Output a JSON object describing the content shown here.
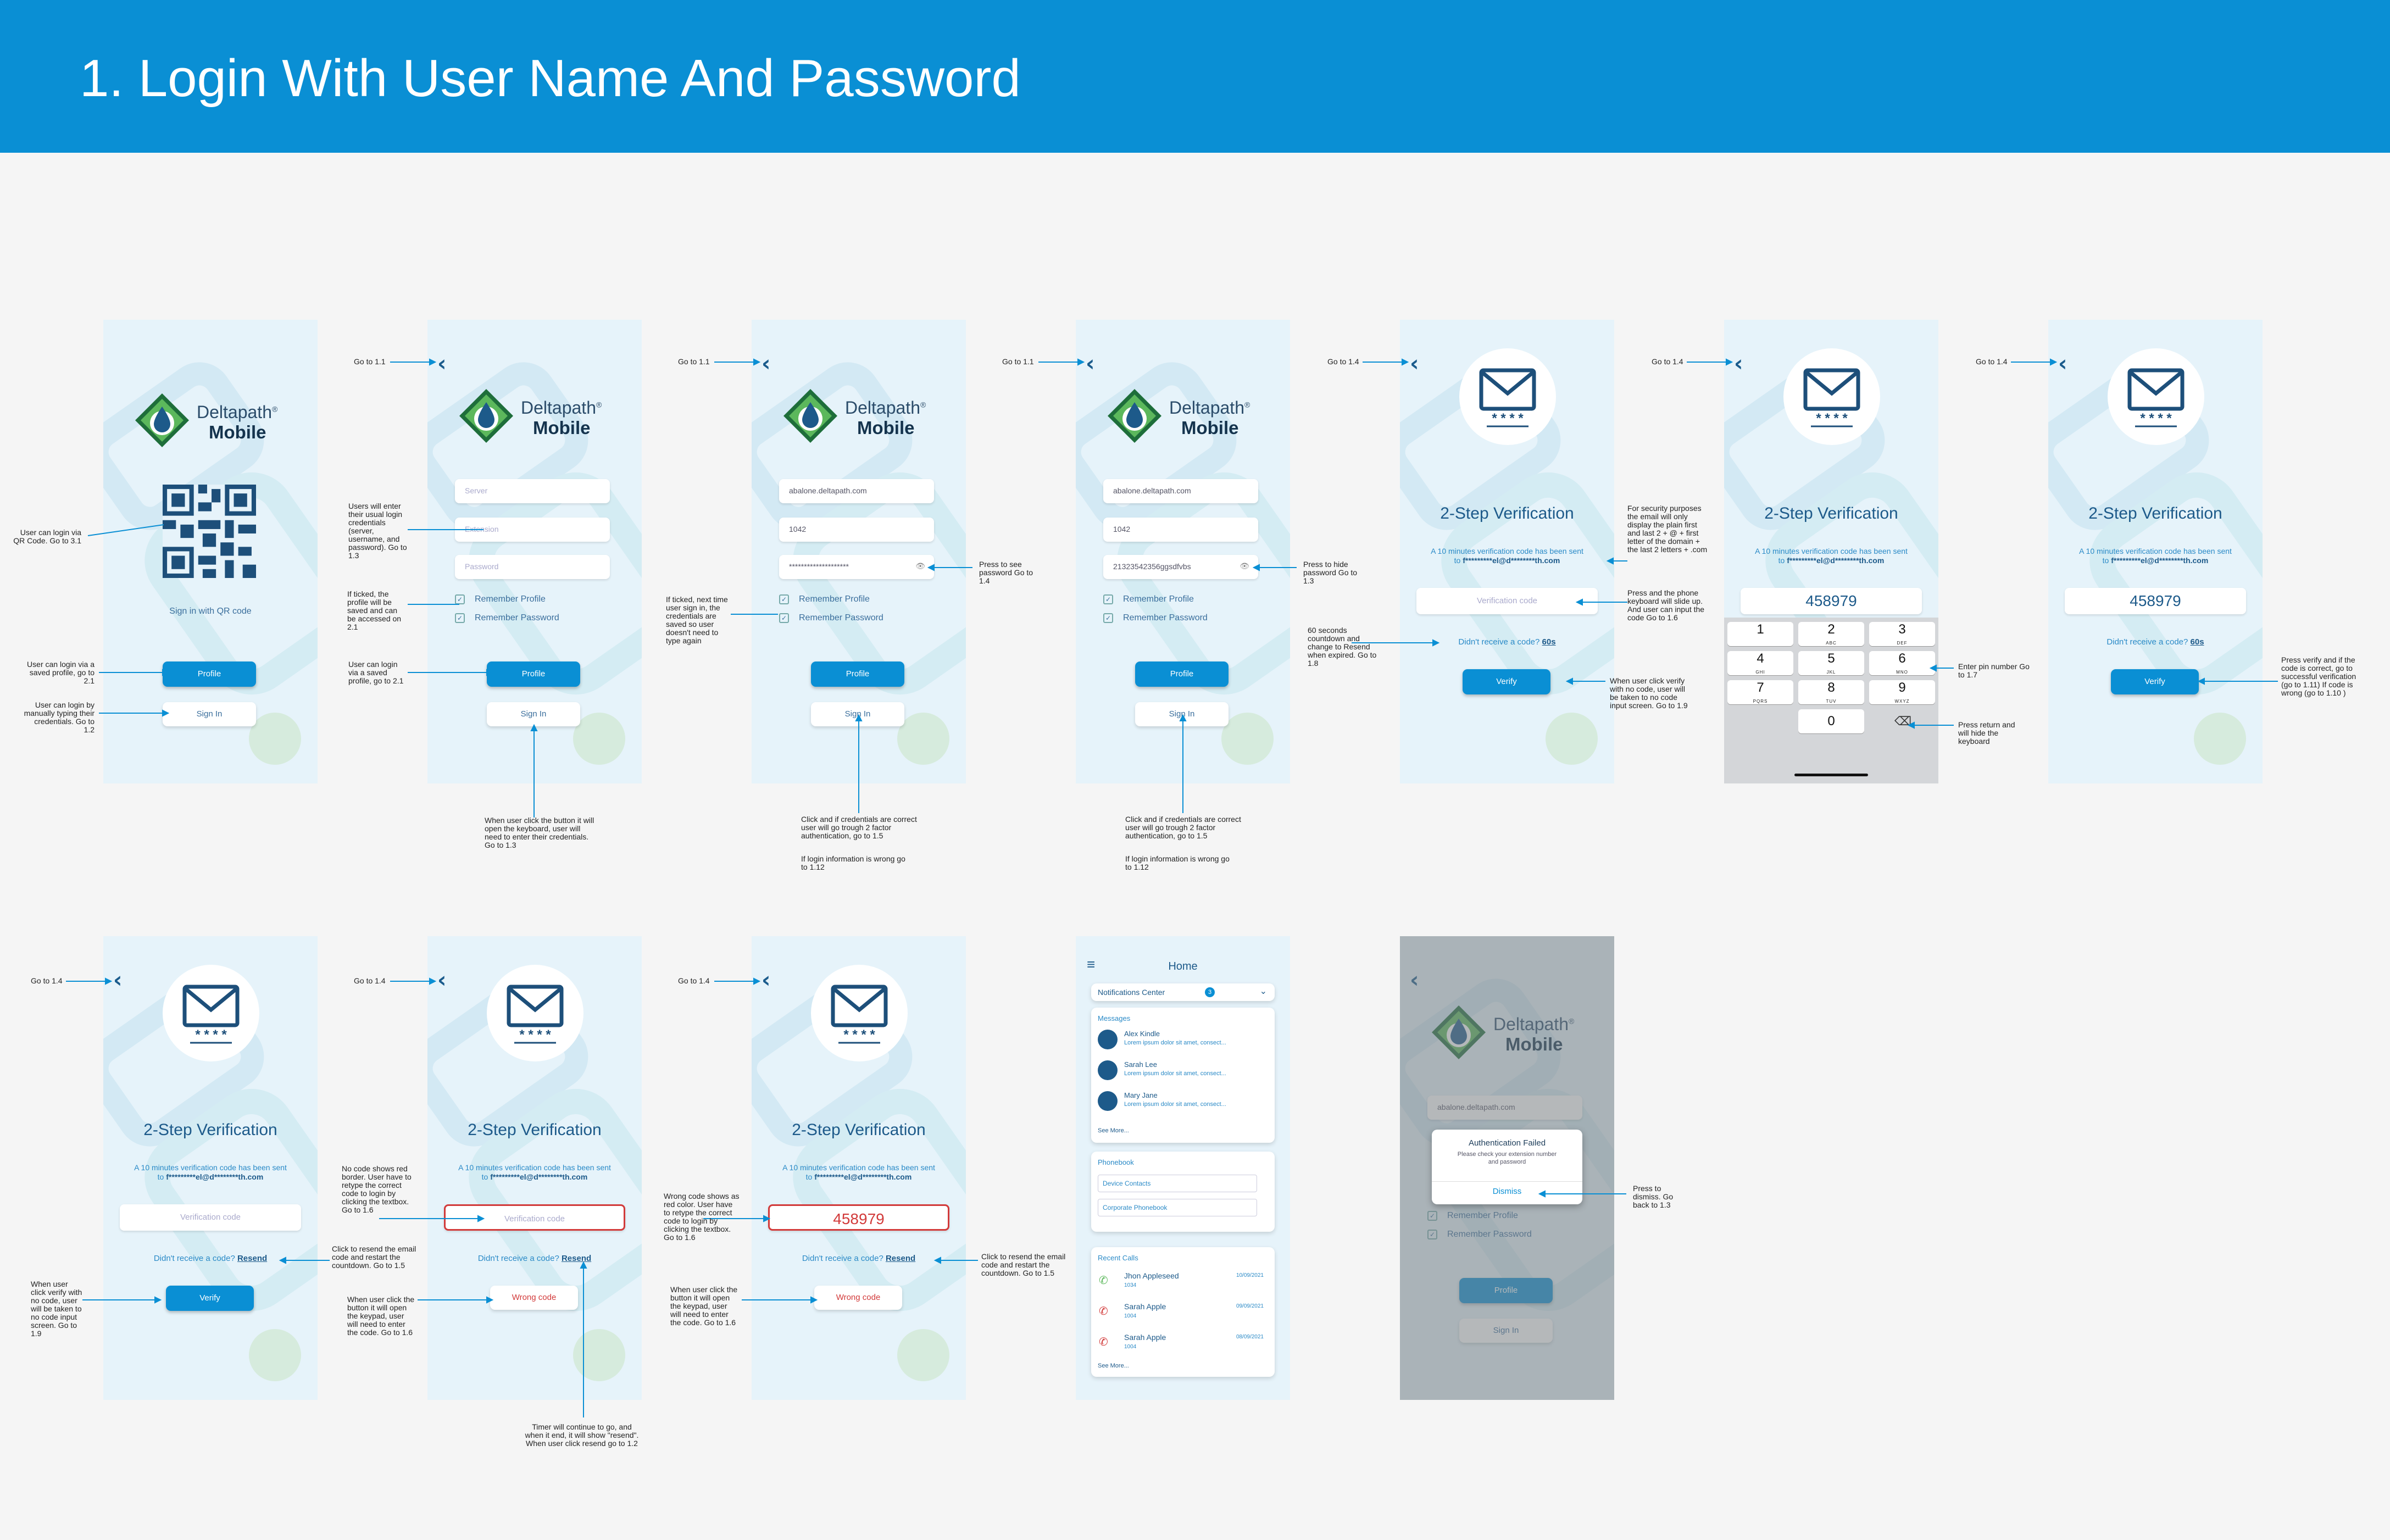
{
  "page_title": "1. Login With User Name And Password",
  "login": {
    "brand": "Deltapath",
    "brand_sub": "Mobile",
    "qr_caption": "Sign in with QR code",
    "profile": "Profile",
    "sign_in": "Sign In",
    "server_ph": "Server",
    "extension_ph": "Extension",
    "password_ph": "Password",
    "server_val": "abalone.deltapath.com",
    "ext_val": "1042",
    "pass_masked": "********************",
    "pass_plain": "21323542356ggsdfvbs",
    "remember_profile": "Remember  Profile",
    "remember_password": "Remember  Password"
  },
  "verify": {
    "title": "2-Step Verification",
    "sub1": "A 10 minutes verification code has been sent",
    "sub2_prefix": "to ",
    "sub2_email": "f*********el@d********th.com",
    "code_ph": "Verification code",
    "code": "458979",
    "resend_prefix": "Didn't receive a code? ",
    "resend_60": "60s",
    "resend": "Resend",
    "verify_btn": "Verify",
    "wrong_btn": "Wrong code",
    "stars": "* * * *"
  },
  "keypad": [
    {
      "n": "1",
      "l": ""
    },
    {
      "n": "2",
      "l": "ABC"
    },
    {
      "n": "3",
      "l": "DEF"
    },
    {
      "n": "4",
      "l": "GHI"
    },
    {
      "n": "5",
      "l": "JKL"
    },
    {
      "n": "6",
      "l": "MNO"
    },
    {
      "n": "7",
      "l": "PQRS"
    },
    {
      "n": "8",
      "l": "TUV"
    },
    {
      "n": "9",
      "l": "WXYZ"
    },
    {
      "n": "0",
      "l": ""
    }
  ],
  "home": {
    "title": "Home",
    "notif": "Notifications Center",
    "notif_count": "3",
    "messages_h": "Messages",
    "messages": [
      {
        "name": "Alex Kindle",
        "text": "Lorem ipsum dolor sit amet, consect..."
      },
      {
        "name": "Sarah Lee",
        "text": "Lorem ipsum dolor sit amet, consect..."
      },
      {
        "name": "Mary Jane",
        "text": "Lorem ipsum dolor sit amet, consect..."
      }
    ],
    "see_more": "See More...",
    "phonebook_h": "Phonebook",
    "device_contacts": "Device Contacts",
    "corporate_pb": "Corporate Phonebook",
    "recent_h": "Recent Calls",
    "calls": [
      {
        "name": "Jhon Appleseed",
        "ext": "1034",
        "date": "10/09/2021"
      },
      {
        "name": "Sarah Apple",
        "ext": "1004",
        "date": "09/09/2021"
      },
      {
        "name": "Sarah Apple",
        "ext": "1004",
        "date": "08/09/2021"
      }
    ]
  },
  "failed": {
    "title": "Authentication Failed",
    "msg": "Please check your extension number and password",
    "dismiss": "Dismiss"
  },
  "annotations": {
    "go11": "Go to 1.1",
    "go14": "Go to 1.4",
    "qr_note": "User can login via QR Code. Go to 3.1",
    "profile_note1": "User can login via a saved profile, go to 2.1",
    "signin_note1": "User can login by manually typing their credentials. Go to 1.2",
    "users_enter": "Users will enter their usual login credentials (server, username, and password). Go to 1.3",
    "ticked_profile": "If ticked, the profile will be saved and can be accessed on 2.1",
    "saved_profile2": "User can login via a saved profile, go to 2.1",
    "keyboard_note": "When user click the button it will open the keyboard, user will need to enter their credentials. Go to 1.3",
    "press_see": "Press to see password Go to 1.4",
    "ticked_next": "If ticked, next time user sign in, the credentials are saved so user doesn't need to type again",
    "click_correct": "Click and if credentials are correct user will go trough 2 factor authentication, go to 1.5",
    "login_wrong": "If login information is wrong go to 1.12",
    "press_hide": "Press to hide password Go to 1.3",
    "security": "For security purposes the email will only display the plain first and last 2 + @ + first letter of the domain + the last 2 letters + .com",
    "phone_kbd": "Press and the phone keyboard will slide up. And user can input the code Go to 1.6",
    "countdown": "60 seconds countdown and change to Resend when expired. Go to 1.8",
    "no_code": "When user click verify with no code, user will be taken to no code input screen. Go to 1.9",
    "enter_pin": "Enter pin number Go to 1.7",
    "press_return": "Press return and will hide the keyboard",
    "press_verify": "Press verify and if the code is correct, go to successful verification (go to 1.11) If code is wrong (go to 1.10 )",
    "verify_nocode": "When user click verify with no code, user will be taken to no code input screen. Go to 1.9",
    "no_code_red": "No code shows red border. User have to retype the correct code to login by clicking the textbox. Go to 1.6",
    "resend_restart": "Click to resend the email code and restart the countdown. Go to 1.5",
    "keypad_open": "When user click the button it will open the keypad, user will need to enter the code. Go to 1.6",
    "timer": "Timer will continue to go, and when it end, it will show \"resend\". When user click resend go to 1.2",
    "wrong_red": "Wrong code shows as red color. User have to retype the correct code to login by clicking the textbox. Go to 1.6",
    "keypad_open2": "When user click the button it will open the keypad, user will need to enter the code. Go to 1.6",
    "resend_restart2": "Click to resend the email code and restart the countdown. Go to 1.5",
    "dismiss_note": "Press to dismiss. Go back to 1.3"
  },
  "colors": {
    "header": "#0a8fd4",
    "accent": "#0a8fd4",
    "error": "#d23a3a"
  }
}
